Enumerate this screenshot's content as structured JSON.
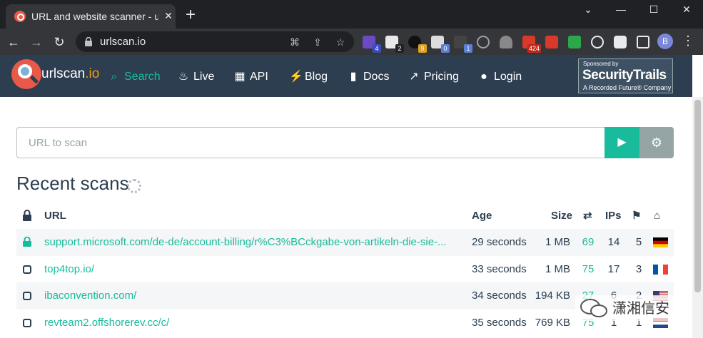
{
  "browser": {
    "tab_title": "URL and website scanner - urlscan.io",
    "tab_close": "✕",
    "new_tab": "+",
    "address": "urlscan.io",
    "ext_badges": [
      "4",
      "2",
      "9",
      "0",
      "1",
      "424"
    ],
    "profile_initial": "B",
    "window_controls": {
      "chevron": "⌄",
      "minimize": "—",
      "maximize": "☐",
      "close": "✕"
    }
  },
  "site": {
    "logo_text": "urlscan",
    "logo_suffix": ".io",
    "nav": [
      {
        "label": "Search",
        "icon": "search-icon"
      },
      {
        "label": "Live",
        "icon": "fire-icon"
      },
      {
        "label": "API",
        "icon": "qrcode-icon"
      },
      {
        "label": "Blog",
        "icon": "bolt-icon"
      },
      {
        "label": "Docs",
        "icon": "bookmark-icon"
      },
      {
        "label": "Pricing",
        "icon": "external-link-icon"
      },
      {
        "label": "Login",
        "icon": "user-icon"
      }
    ],
    "sponsor": {
      "small": "Sponsored by",
      "name": "SecurityTrails",
      "sub": "A Recorded Future® Company"
    }
  },
  "scan": {
    "placeholder": "URL to scan"
  },
  "recent": {
    "title": "Recent scans",
    "headers": {
      "url": "URL",
      "age": "Age",
      "size": "Size",
      "ips": "IPs"
    },
    "rows": [
      {
        "url": "support.microsoft.com/de-de/account-billing/r%C3%BCckgabe-von-artikeln-die-sie-...",
        "age": "29 seconds",
        "size": "1 MB",
        "requests": "69",
        "ips": "14",
        "countries": "5",
        "secure": true,
        "flag": "de"
      },
      {
        "url": "top4top.io/",
        "age": "33 seconds",
        "size": "1 MB",
        "requests": "75",
        "ips": "17",
        "countries": "3",
        "secure": false,
        "flag": "fr"
      },
      {
        "url": "ibaconvention.com/",
        "age": "34 seconds",
        "size": "194 KB",
        "requests": "27",
        "ips": "6",
        "countries": "2",
        "secure": false,
        "flag": "us"
      },
      {
        "url": "revteam2.offshorerev.cc/c/",
        "age": "35 seconds",
        "size": "769 KB",
        "requests": "75",
        "ips": "1",
        "countries": "1",
        "secure": false,
        "flag": "nl"
      }
    ]
  },
  "watermark": "潇湘信安",
  "colors": {
    "header_bg": "#2c3e50",
    "accent": "#18bc9c",
    "logo": "#e8594a",
    "text": "#2c3e50"
  }
}
